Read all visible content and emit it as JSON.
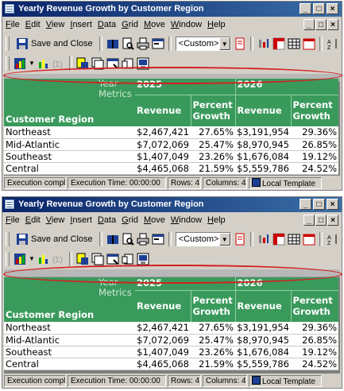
{
  "screens": [
    {
      "title": "Yearly Revenue Growth by Customer Region",
      "menu": [
        "File",
        "Edit",
        "View",
        "Insert",
        "Data",
        "Grid",
        "Move",
        "Window",
        "Help"
      ],
      "toolbar": {
        "save_label": "Save and Close",
        "template_value": "<Custom>"
      },
      "grid": {
        "year_metrics": "Year Metrics",
        "region_header": "Customer Region",
        "years": [
          "2025",
          "2026"
        ],
        "metrics": [
          "Revenue",
          "Percent Growth",
          "Revenue",
          "Percent Growth"
        ],
        "rows": [
          {
            "region": "Northeast",
            "values": [
              "$2,467,421",
              "27.65%",
              "$3,191,954",
              "29.36%"
            ]
          },
          {
            "region": "Mid-Atlantic",
            "values": [
              "$7,072,069",
              "25.47%",
              "$8,970,945",
              "26.85%"
            ]
          },
          {
            "region": "Southeast",
            "values": [
              "$1,407,049",
              "23.26%",
              "$1,676,084",
              "19.12%"
            ]
          },
          {
            "region": "Central",
            "values": [
              "$4,465,068",
              "21.59%",
              "$5,559,786",
              "24.52%"
            ]
          }
        ]
      },
      "status": [
        "Execution complete",
        "Execution Time: 00:00:00",
        "Rows: 4",
        "Columns: 4",
        "Local Template"
      ]
    },
    {
      "title": "Yearly Revenue Growth by Customer Region",
      "menu": [
        "File",
        "Edit",
        "View",
        "Insert",
        "Data",
        "Grid",
        "Move",
        "Window",
        "Help"
      ],
      "toolbar": {
        "save_label": "Save and Close",
        "template_value": "<Custom>"
      },
      "grid": {
        "year_metrics": "Year Metrics",
        "region_header": "Customer Region",
        "years": [
          "2025",
          "2026"
        ],
        "metrics": [
          "Revenue",
          "Percent Growth",
          "Revenue",
          "Percent Growth"
        ],
        "rows": [
          {
            "region": "Northeast",
            "values": [
              "$2,467,421",
              "27.65%",
              "$3,191,954",
              "29.36%"
            ]
          },
          {
            "region": "Mid-Atlantic",
            "values": [
              "$7,072,069",
              "25.47%",
              "$8,970,945",
              "26.85%"
            ]
          },
          {
            "region": "Southeast",
            "values": [
              "$1,407,049",
              "23.26%",
              "$1,676,084",
              "19.12%"
            ]
          },
          {
            "region": "Central",
            "values": [
              "$4,465,068",
              "21.59%",
              "$5,559,786",
              "24.52%"
            ]
          }
        ]
      },
      "status": [
        "Execution complete",
        "Execution Time: 00:00:00",
        "Rows: 4",
        "Columns: 4",
        "Local Template"
      ]
    }
  ],
  "colors": {
    "title_bar": "#0a246a",
    "grid_header": "#3a9a5c",
    "highlight_oval": "#d42020"
  },
  "icons": [
    "save-icon",
    "book-icon",
    "print-preview-icon",
    "print-icon",
    "properties-icon",
    "graph-icon",
    "pivot-icon",
    "grid-icon",
    "sort-icon",
    "chart-icon",
    "formula-icon",
    "filter-icon",
    "page-icon",
    "export-icon"
  ]
}
